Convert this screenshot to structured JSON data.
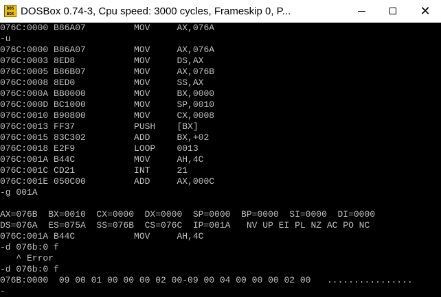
{
  "window": {
    "title": "DOSBox 0.74-3, Cpu speed:     3000 cycles, Frameskip  0, P...",
    "icon_text": "DOS\nBOX",
    "buttons": {
      "minimize": "–",
      "maximize": "□",
      "close": "✕"
    }
  },
  "console": {
    "lines": [
      "076C:0000 B86A07         MOV     AX,076A",
      "-u",
      "076C:0000 B86A07         MOV     AX,076A",
      "076C:0003 8ED8           MOV     DS,AX",
      "076C:0005 B86B07         MOV     AX,076B",
      "076C:0008 8ED0           MOV     SS,AX",
      "076C:000A BB0000         MOV     BX,0000",
      "076C:000D BC1000         MOV     SP,0010",
      "076C:0010 B90800         MOV     CX,0008",
      "076C:0013 FF37           PUSH    [BX]",
      "076C:0015 83C302         ADD     BX,+02",
      "076C:0018 E2F9           LOOP    0013",
      "076C:001A B44C           MOV     AH,4C",
      "076C:001C CD21           INT     21",
      "076C:001E 050C00         ADD     AX,000C",
      "-g 001A",
      "",
      "AX=076B  BX=0010  CX=0000  DX=0000  SP=0000  BP=0000  SI=0000  DI=0000",
      "DS=076A  ES=075A  SS=076B  CS=076C  IP=001A   NV UP EI PL NZ AC PO NC",
      "076C:001A B44C           MOV     AH,4C",
      "-d 076b:0 f",
      "   ^ Error",
      "-d 076b:0 f",
      "076B:0000  09 00 01 00 00 00 02 00-09 00 04 00 00 00 02 00   ................",
      "-"
    ]
  }
}
